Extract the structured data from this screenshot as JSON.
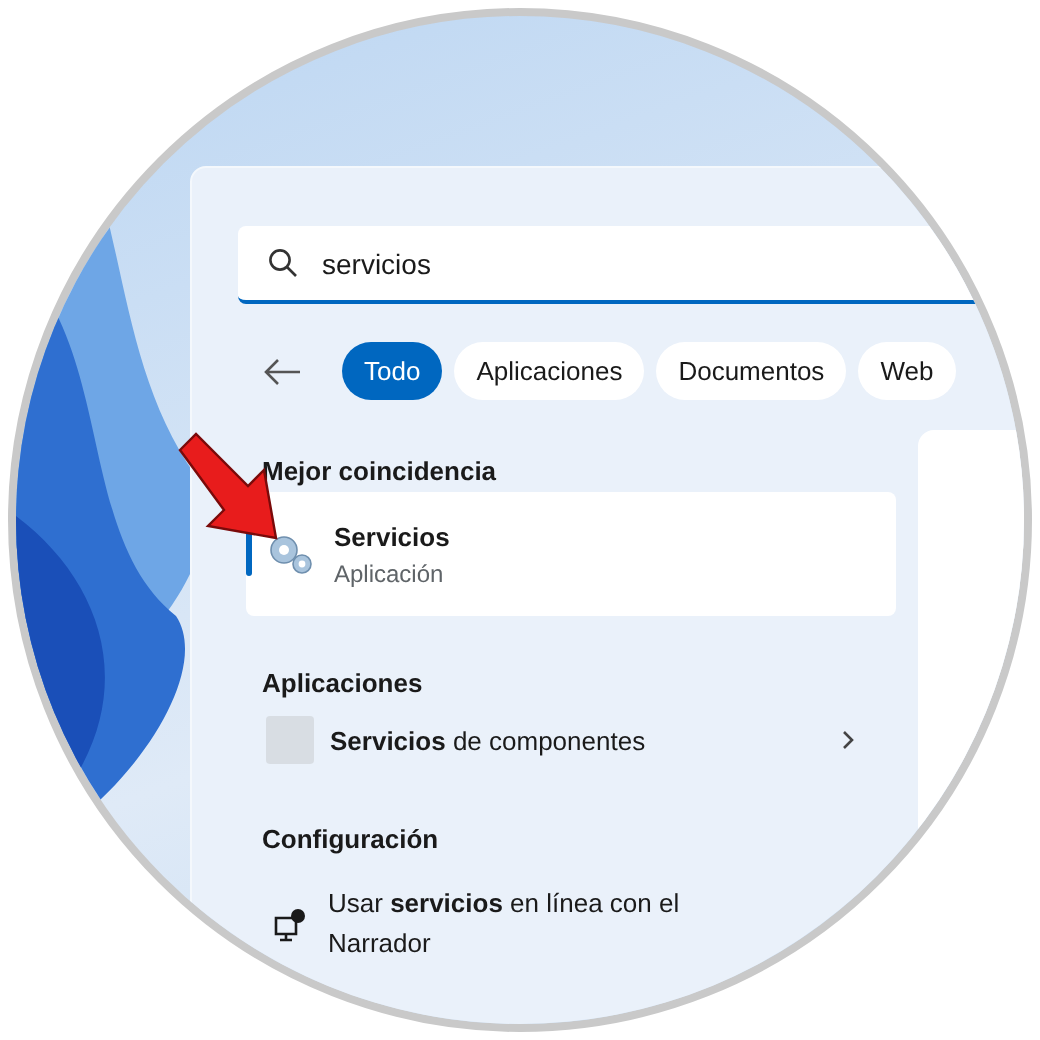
{
  "search": {
    "value": "servicios"
  },
  "filters": [
    {
      "label": "Todo",
      "selected": true
    },
    {
      "label": "Aplicaciones",
      "selected": false
    },
    {
      "label": "Documentos",
      "selected": false
    },
    {
      "label": "Web",
      "selected": false
    }
  ],
  "best_match": {
    "heading": "Mejor coincidencia",
    "title": "Servicios",
    "subtitle": "Aplicación",
    "selected": true
  },
  "sections": [
    {
      "heading": "Aplicaciones",
      "items": [
        {
          "kind": "app",
          "label": "**Servicios** de componentes",
          "expandable": true
        }
      ]
    },
    {
      "heading": "Configuración",
      "items": [
        {
          "kind": "setting",
          "label": "Usar **servicios** en línea con el Narrador",
          "expandable": false
        }
      ]
    }
  ]
}
